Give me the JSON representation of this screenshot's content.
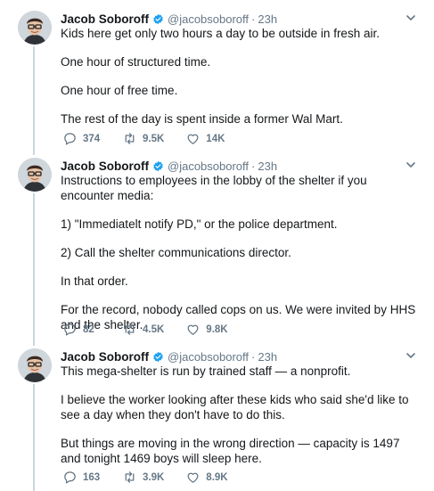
{
  "tweets": [
    {
      "name": "Jacob Soboroff",
      "handle": "@jacobsoboroff",
      "time": "23h",
      "paragraphs": [
        "Kids here get only two hours a day to be outside in fresh air.",
        "One hour of structured time.",
        "One hour of free time.",
        "The rest of the day is spent inside a former Wal Mart."
      ],
      "replies": "374",
      "retweets": "9.5K",
      "likes": "14K"
    },
    {
      "name": "Jacob Soboroff",
      "handle": "@jacobsoboroff",
      "time": "23h",
      "paragraphs": [
        "Instructions to employees in the lobby of the shelter if you encounter media:",
        "1) \"Immediatelt notify PD,\" or the police department.",
        "2) Call the shelter communications director.",
        "In that order.",
        "For the record, nobody called cops on us. We were invited by HHS and the shelter."
      ],
      "replies": "82",
      "retweets": "4.5K",
      "likes": "9.8K"
    },
    {
      "name": "Jacob Soboroff",
      "handle": "@jacobsoboroff",
      "time": "23h",
      "paragraphs": [
        "This mega-shelter is run by trained staff — a nonprofit.",
        "I believe the worker looking after these kids who said she'd like to see a day when they don't have to do this.",
        "But things are moving in the wrong direction — capacity is 1497 and tonight 1469 boys will sleep here."
      ],
      "replies": "163",
      "retweets": "3.9K",
      "likes": "8.9K"
    }
  ],
  "colors": {
    "verified": "#1da1f2",
    "muted": "#657786",
    "thread_line": "#ccd6dd"
  },
  "icons": [
    "verified-badge-icon",
    "chevron-down-icon",
    "reply-icon",
    "retweet-icon",
    "like-icon"
  ]
}
